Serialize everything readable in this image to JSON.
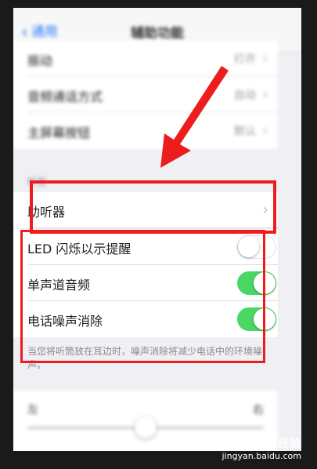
{
  "navbar": {
    "back_label": "通用",
    "title": "辅助功能"
  },
  "top_rows": [
    {
      "label": "振动",
      "value": "打开"
    },
    {
      "label": "音频通话方式",
      "value": "自动"
    },
    {
      "label": "主屏幕按钮",
      "value": "默认"
    }
  ],
  "hearing_section": {
    "header": "听觉"
  },
  "hearing_aids": {
    "label": "助听器"
  },
  "toggles": [
    {
      "label": "LED 闪烁以示提醒",
      "state": "off"
    },
    {
      "label": "单声道音频",
      "state": "on"
    },
    {
      "label": "电话噪声消除",
      "state": "on"
    }
  ],
  "footnote": "当您将听筒放在耳边时，噪声消除将减少电话中的环境噪声。",
  "balance": {
    "left": "左",
    "right": "右"
  },
  "colors": {
    "toggle_on": "#4bd763",
    "highlight": "#ee1d1d",
    "link": "#2f7cf6"
  },
  "watermark": {
    "brand": "Baidu经验",
    "url": "jingyan.baidu.com"
  }
}
